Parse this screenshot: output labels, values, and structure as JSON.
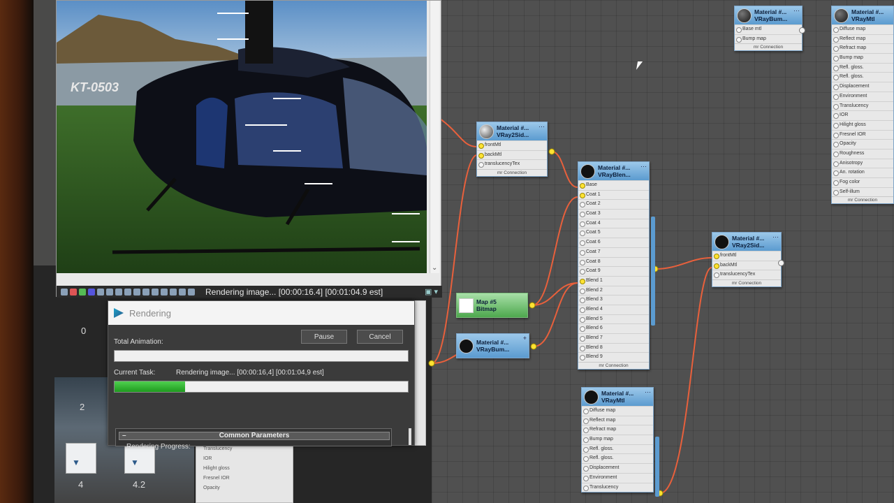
{
  "render_frame": {
    "status_text": "Rendering image... [00:00:16.4] [00:01:04.9 est]",
    "photo_text": "KT-0503"
  },
  "render_dialog": {
    "title": "Rendering",
    "total_animation_label": "Total Animation:",
    "pause_label": "Pause",
    "cancel_label": "Cancel",
    "current_task_label": "Current Task:",
    "current_task_value": "Rendering image... [00:00:16,4] [00:01:04,9 est]",
    "total_progress": 0.0,
    "task_progress": 0.24,
    "rollout_title": "Common Parameters",
    "rollout_minus": "–",
    "rendering_progress_label": "Rendering Progress:"
  },
  "left_panel": {
    "numbers": [
      "0",
      "2",
      "4",
      "4.2"
    ]
  },
  "nodes": {
    "bump_top": {
      "title1": "Material #...",
      "title2": "VRayBum...",
      "slots": [
        "Base mtl",
        "Bump map"
      ],
      "footer": "mr Connection"
    },
    "vraymtl_top": {
      "title1": "Material #...",
      "title2": "VRayMtl",
      "footer": "mr Connection",
      "slots": [
        "Diffuse map",
        "Reflect map",
        "Refract map",
        "Bump map",
        "Refl. gloss.",
        "Refl. gloss.",
        "Displacement",
        "Environment",
        "Translucency",
        "IOR",
        "Hilight gloss",
        "Fresnel IOR",
        "Opacity",
        "Roughness",
        "Anisotropy",
        "An. rotation",
        "Fog color",
        "Self-illum"
      ]
    },
    "twoside_1": {
      "title1": "Material #...",
      "title2": "VRay2Sid...",
      "slots": [
        "frontMtl",
        "backMtl",
        "translucencyTex"
      ],
      "footer": "mr Connection"
    },
    "blend": {
      "title1": "Material #...",
      "title2": "VRayBlen...",
      "footer": "mr Connection",
      "slots": [
        "Base",
        "Coat 1",
        "Coat 2",
        "Coat 3",
        "Coat 4",
        "Coat 5",
        "Coat 6",
        "Coat 7",
        "Coat 8",
        "Coat 9",
        "Blend 1",
        "Blend 2",
        "Blend 3",
        "Blend 4",
        "Blend 5",
        "Blend 6",
        "Blend 7",
        "Blend 8",
        "Blend 9"
      ]
    },
    "bitmap": {
      "title1": "Map #5",
      "title2": "Bitmap"
    },
    "bump_mid": {
      "title1": "Material #...",
      "title2": "VRayBum..."
    },
    "twoside_2": {
      "title1": "Material #...",
      "title2": "VRay2Sid...",
      "slots": [
        "frontMtl",
        "backMtl",
        "translucencyTex"
      ],
      "footer": "mr Connection"
    },
    "vraymtl_bottom": {
      "title1": "Material #...",
      "title2": "VRayMtl",
      "slots": [
        "Diffuse map",
        "Reflect map",
        "Refract map",
        "Bump map",
        "Refl. gloss.",
        "Refl. gloss.",
        "Displacement",
        "Environment",
        "Translucency"
      ]
    },
    "partial_bottom": {
      "slots": [
        "Translucency",
        "IOR",
        "Hilight gloss",
        "Fresnel IOR",
        "Opacity"
      ]
    }
  },
  "colors": {
    "wire": "#e8603c",
    "node_header": "#5b9bd0",
    "socket_on": "#ffe233",
    "progress": "#2fb82f"
  }
}
